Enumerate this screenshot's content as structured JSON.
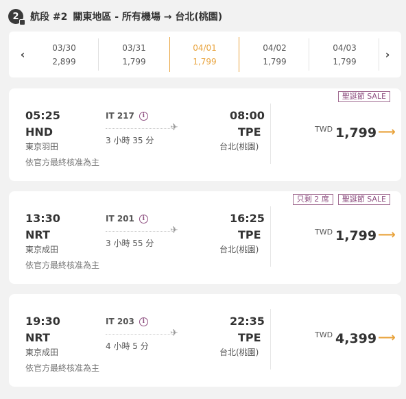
{
  "segment": {
    "number": "2",
    "label": "航段 #2",
    "route": "關東地區 - 所有機場 → 台北(桃園)"
  },
  "dates": [
    {
      "date": "03/30",
      "price": "2,899",
      "active": false
    },
    {
      "date": "03/31",
      "price": "1,799",
      "active": false
    },
    {
      "date": "04/01",
      "price": "1,799",
      "active": true
    },
    {
      "date": "04/02",
      "price": "1,799",
      "active": false
    },
    {
      "date": "04/03",
      "price": "1,799",
      "active": false
    }
  ],
  "date_nav": {
    "prev": "‹",
    "next": "›"
  },
  "flights": [
    {
      "tags": [
        "聖誕節 SALE"
      ],
      "dep_time": "05:25",
      "dep_code": "HND",
      "dep_city": "東京羽田",
      "flight_no": "IT 217",
      "duration": "3 小時 35 分",
      "arr_time": "08:00",
      "arr_code": "TPE",
      "arr_city": "台北(桃園)",
      "note": "依官方最終核准為主",
      "currency": "TWD",
      "price": "1,799"
    },
    {
      "tags": [
        "只剩 2 席",
        "聖誕節 SALE"
      ],
      "dep_time": "13:30",
      "dep_code": "NRT",
      "dep_city": "東京成田",
      "flight_no": "IT 201",
      "duration": "3 小時 55 分",
      "arr_time": "16:25",
      "arr_code": "TPE",
      "arr_city": "台北(桃園)",
      "note": "依官方最終核准為主",
      "currency": "TWD",
      "price": "1,799"
    },
    {
      "tags": [],
      "dep_time": "19:30",
      "dep_code": "NRT",
      "dep_city": "東京成田",
      "flight_no": "IT 203",
      "duration": "4 小時 5 分",
      "arr_time": "22:35",
      "arr_code": "TPE",
      "arr_city": "台北(桃園)",
      "note": "依官方最終核准為主",
      "currency": "TWD",
      "price": "4,399"
    }
  ],
  "icons": {
    "info": "i",
    "plane": "✈",
    "arrow": "⟶"
  },
  "colors": {
    "accent": "#e8a23a",
    "tag": "#8e4f80",
    "background": "#f2f2f2"
  }
}
